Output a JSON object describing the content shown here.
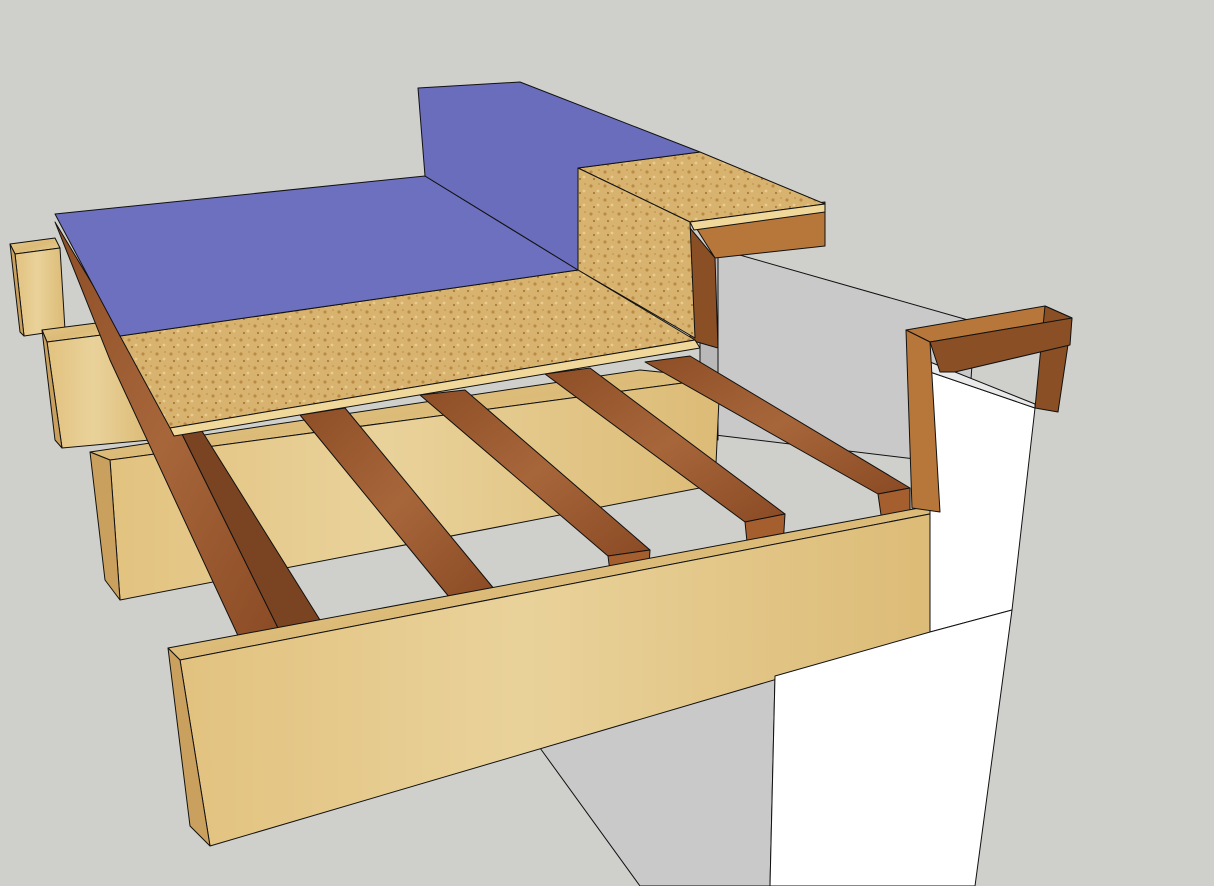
{
  "scene": {
    "description_visible_text": "",
    "colors": {
      "background": "#cfcfcb",
      "membrane": "#6d70bf",
      "osb": "#d6b070",
      "beam_wood": "#e0c07e",
      "joist_wood": "#94532a",
      "wall_grey": "#c9c9c9",
      "wall_white": "#ffffff"
    }
  }
}
